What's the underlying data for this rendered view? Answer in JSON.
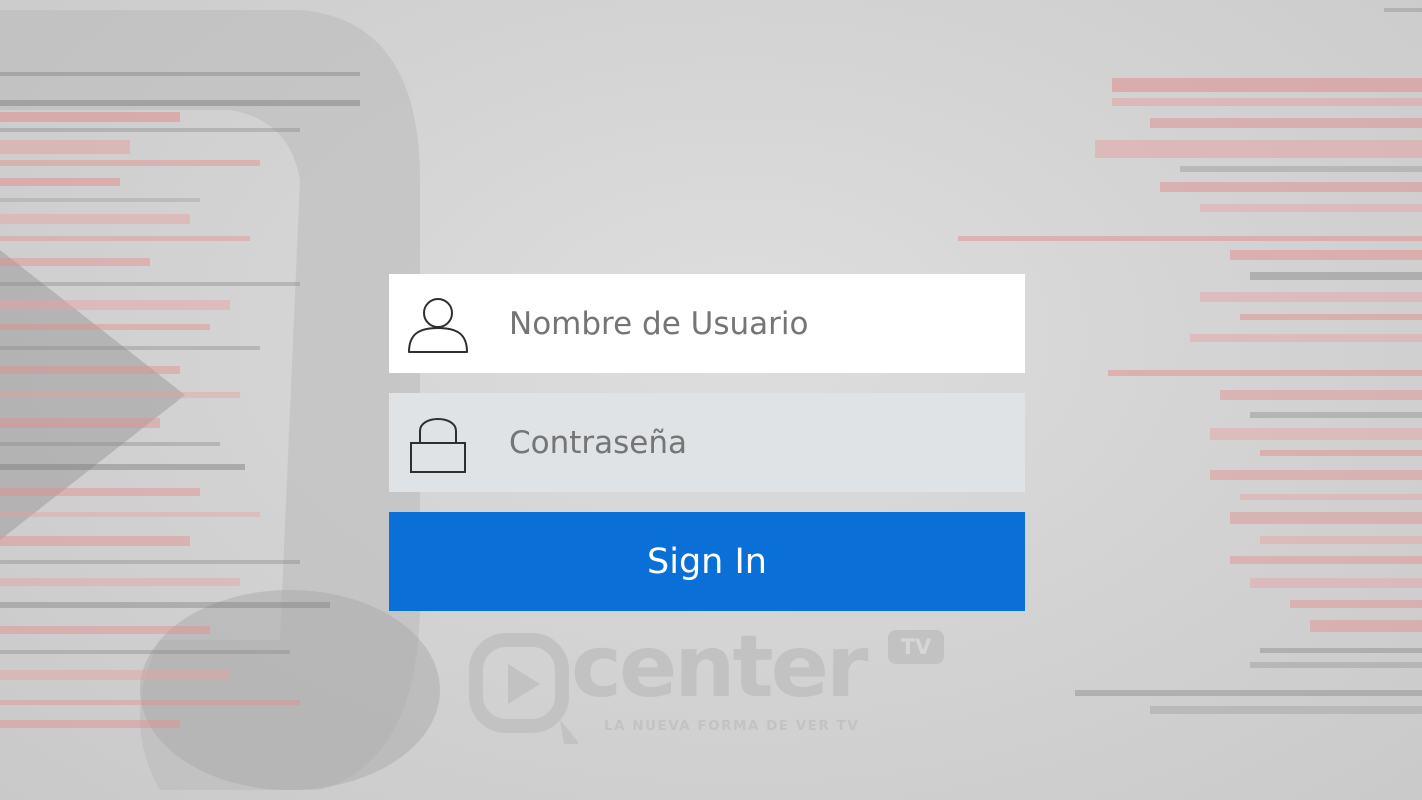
{
  "login": {
    "username_placeholder": "Nombre de Usuario",
    "password_placeholder": "Contraseña",
    "signin_label": "Sign In"
  },
  "logo": {
    "word": "center",
    "badge": "TV",
    "tagline": "LA NUEVA FORMA DE VER TV"
  },
  "colors": {
    "button_bg": "#0a6fd6",
    "button_text": "#ffffff",
    "username_bg": "#ffffff",
    "password_bg": "#dfe3e6",
    "placeholder_text": "#757575",
    "background": "#d2d2d2",
    "glitch_red": "#e28c8c"
  },
  "icons": {
    "username": "user-icon",
    "password": "lock-icon",
    "logo": "play-icon"
  }
}
